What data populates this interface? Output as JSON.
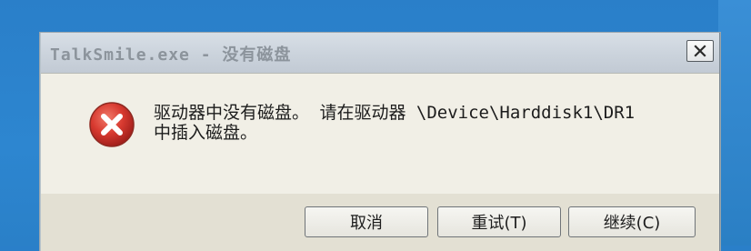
{
  "dialog": {
    "title": "TalkSmile.exe - 没有磁盘",
    "close_glyph": "X",
    "icon": "error-icon",
    "message_line1": "驱动器中没有磁盘。 请在驱动器 \\Device\\Harddisk1\\DR1",
    "message_line2": "中插入磁盘。",
    "buttons": {
      "cancel": "取消",
      "retry": "重试(T)",
      "continue": "继续(C)"
    }
  },
  "colors": {
    "error_red": "#cc2a2a",
    "desktop_blue": "#2d86d0"
  }
}
